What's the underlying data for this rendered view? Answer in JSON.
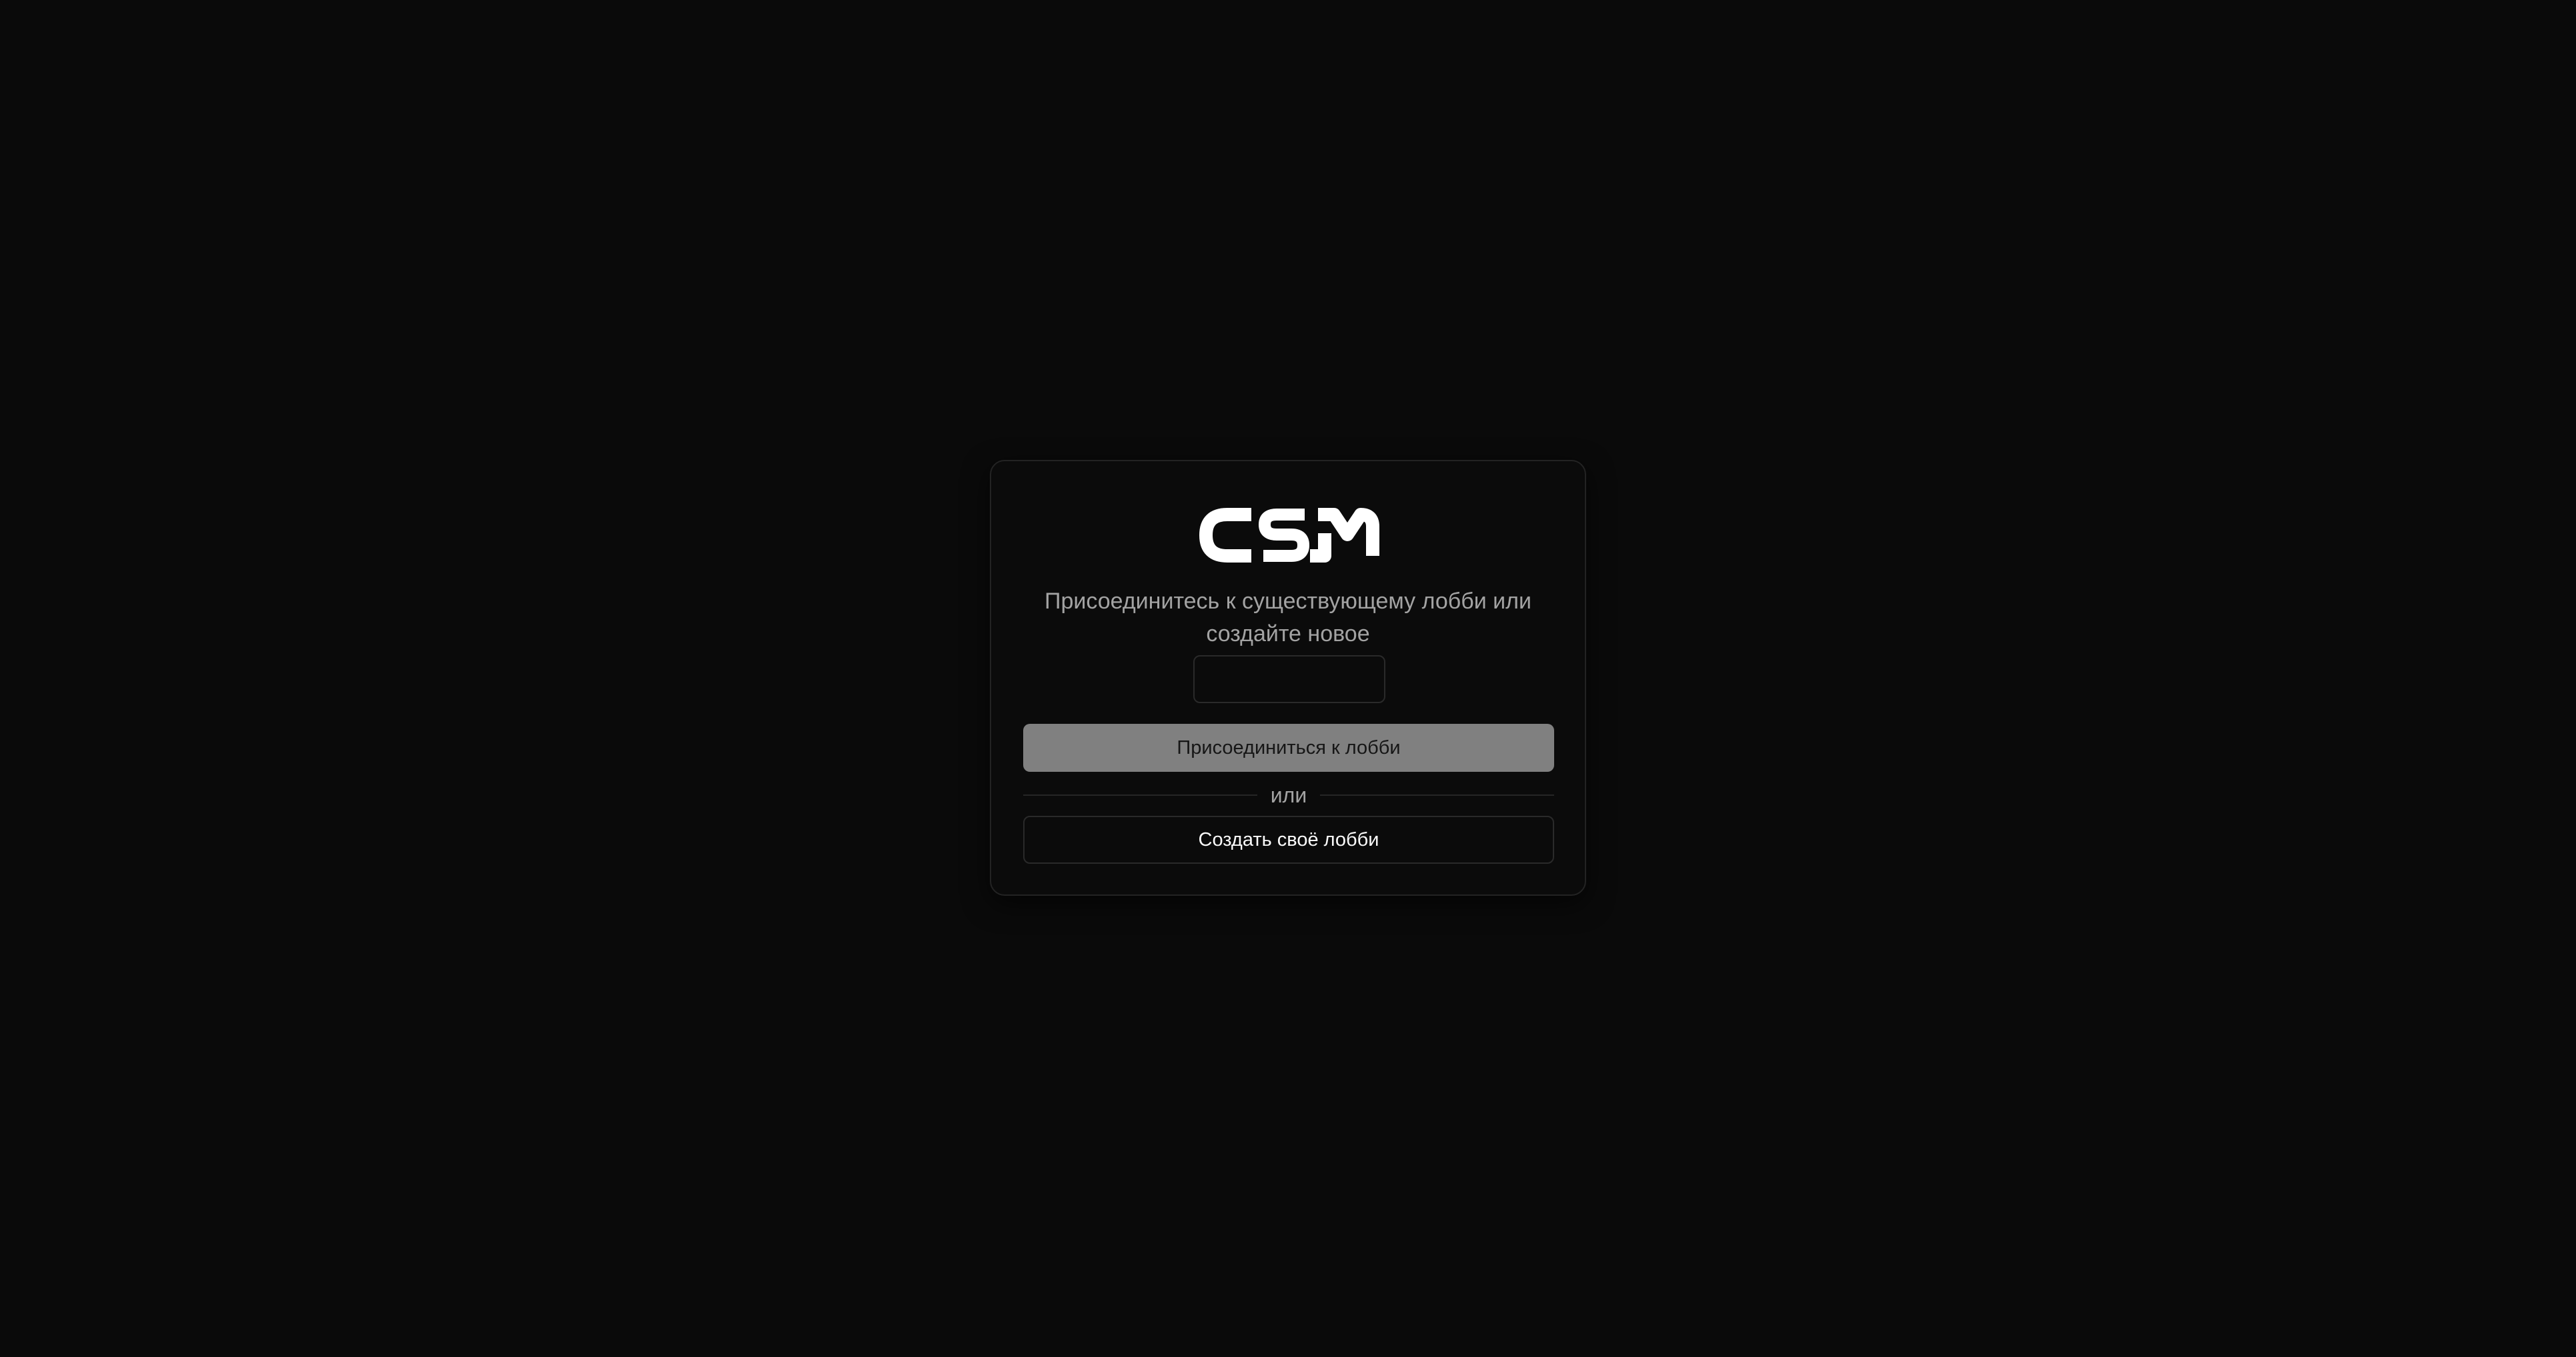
{
  "app": {
    "logo_text": "CSM"
  },
  "lobby": {
    "subtitle": "Присоединитесь к существующему лобби или создайте новое",
    "code_cells": [
      "",
      "",
      "",
      ""
    ],
    "join_label": "Присоединиться к лобби",
    "divider_text": "или",
    "create_label": "Создать своё лобби"
  },
  "colors": {
    "background": "#0a0a0a",
    "card_border": "#232323",
    "join_button_bg": "#808080",
    "text_muted": "#a3a3a3",
    "text_primary": "#fafafa"
  },
  "icons": {
    "logo": "csm-logo-icon"
  }
}
